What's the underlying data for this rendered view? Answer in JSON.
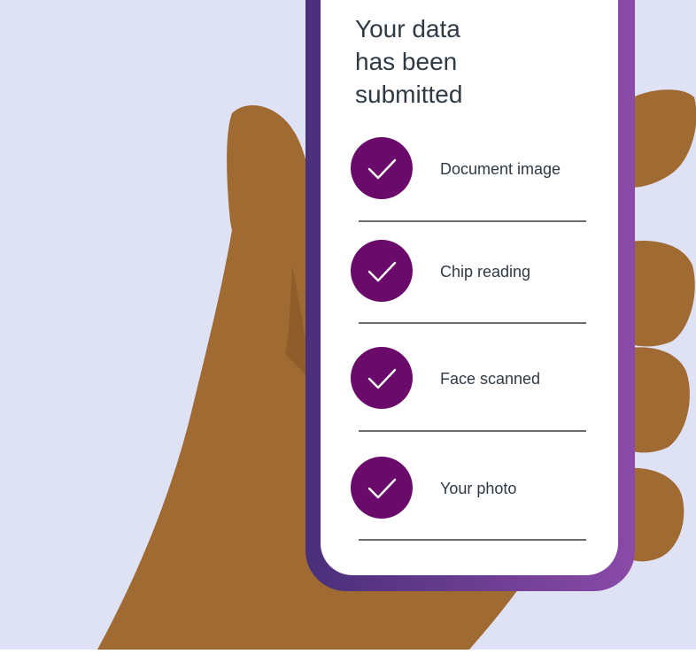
{
  "colors": {
    "background": "#dfe1f5",
    "skin": "#a06a33",
    "skin_shadow": "#8f5c2a",
    "phone_frame_start": "#4a2f7a",
    "phone_frame_end": "#8a4aa8",
    "screen": "#ffffff",
    "check_circle": "#6a0a6b",
    "divider": "#3c3c3c"
  },
  "screen": {
    "headline_lines": [
      "Your data",
      "has been",
      "submitted"
    ],
    "items": [
      {
        "label": "Document image",
        "icon": "checkmark-icon"
      },
      {
        "label": "Chip reading",
        "icon": "checkmark-icon"
      },
      {
        "label": "Face scanned",
        "icon": "checkmark-icon"
      },
      {
        "label": "Your photo",
        "icon": "checkmark-icon"
      }
    ]
  }
}
